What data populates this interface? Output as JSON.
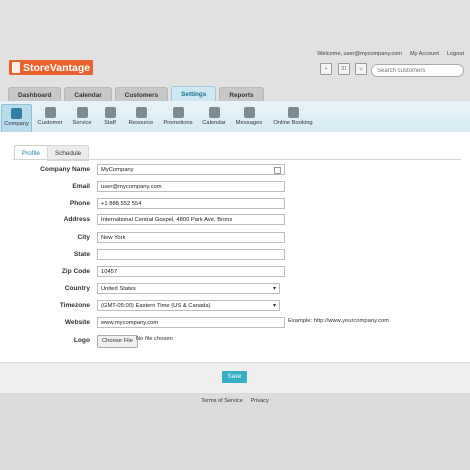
{
  "brand": {
    "name": "StoreVantage",
    "color": "#e8622d"
  },
  "header": {
    "welcome": "Welcome, user@mycompany.com",
    "my_account": "My Account",
    "logout": "Logout",
    "search_placeholder": "Search customers"
  },
  "tabs": [
    "Dashboard",
    "Calendar",
    "Customers",
    "Settings",
    "Reports"
  ],
  "subnav": [
    "Company",
    "Customer",
    "Service",
    "Staff",
    "Resource",
    "Promotions",
    "Calendar",
    "Messages",
    "Online Booking"
  ],
  "form_tabs": {
    "profile": "Profile",
    "schedule": "Schedule"
  },
  "labels": {
    "company_name": "Company Name",
    "email": "Email",
    "phone": "Phone",
    "address": "Address",
    "city": "City",
    "state": "State",
    "zip": "Zip Code",
    "country": "Country",
    "timezone": "Timezone",
    "website": "Website",
    "logo": "Logo"
  },
  "values": {
    "company_name": "MyCompany",
    "email": "user@mycompany.com",
    "phone": "+1 888 552 554",
    "address": "International Central Gospel, 4800 Park Ave, Bronx",
    "city": "New York",
    "state": "",
    "zip": "10457",
    "country": "United States",
    "timezone": "(GMT-05:00) Eastern Time (US & Canada)",
    "website": "www.mycompany.com"
  },
  "website_example": "Example: http://www.yourcompany.com",
  "file": {
    "button": "Choose File",
    "status": "No file chosen"
  },
  "save_label": "Save",
  "footer_links": {
    "terms": "Terms of Service",
    "privacy": "Privacy"
  }
}
